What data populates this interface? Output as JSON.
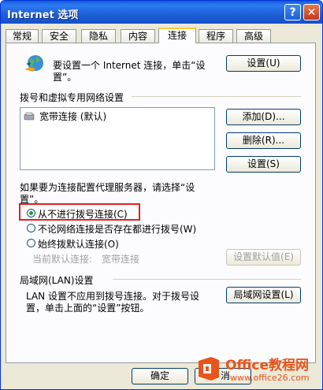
{
  "window": {
    "title": "Internet 选项",
    "help_glyph": "?",
    "close_glyph": "✕"
  },
  "tabs": [
    {
      "label": "常规"
    },
    {
      "label": "安全"
    },
    {
      "label": "隐私"
    },
    {
      "label": "内容"
    },
    {
      "label": "连接"
    },
    {
      "label": "程序"
    },
    {
      "label": "高级"
    }
  ],
  "active_tab": "连接",
  "connect": {
    "setup_text_line1": "要设置一个 Internet 连接，单击“设",
    "setup_text_line2": "置”。",
    "setup_button": "设置(U)"
  },
  "dialup": {
    "section_label": "拨号和虚拟专用网络设置",
    "list_items": [
      {
        "label": "宽带连接 (默认)"
      }
    ],
    "add_button": "添加(D)...",
    "remove_button": "删除(R)...",
    "settings_button": "设置(S)"
  },
  "proxy": {
    "hint_line1": "如果要为连接配置代理服务器，请选择“设",
    "hint_line2": "置”。",
    "options": [
      {
        "label": "从不进行拨号连接(C)",
        "selected": true
      },
      {
        "label": "不论网络连接是否存在都进行拨号(W)",
        "selected": false
      },
      {
        "label": "始终拨默认连接(O)",
        "selected": false
      }
    ],
    "current_default_label": "当前默认连接:",
    "current_default_value": "宽带连接",
    "set_default_button": "设置默认值(E)"
  },
  "lan": {
    "section_label": "局域网(LAN)设置",
    "text_line1": "LAN 设置不应用到拨号连接。对于拨号设",
    "text_line2": "置，单击上面的“设置”按钮。",
    "lan_button": "局域网设置(L)"
  },
  "footer": {
    "ok_button": "确定",
    "cancel_partial": "消"
  },
  "watermark": {
    "brand": "Office教程网",
    "url": "www.office26.com"
  },
  "colors": {
    "title_bar": "#1c5fd6",
    "face": "#ece9d8",
    "highlight_box": "#e02020",
    "watermark_orange": "#e8541b"
  }
}
